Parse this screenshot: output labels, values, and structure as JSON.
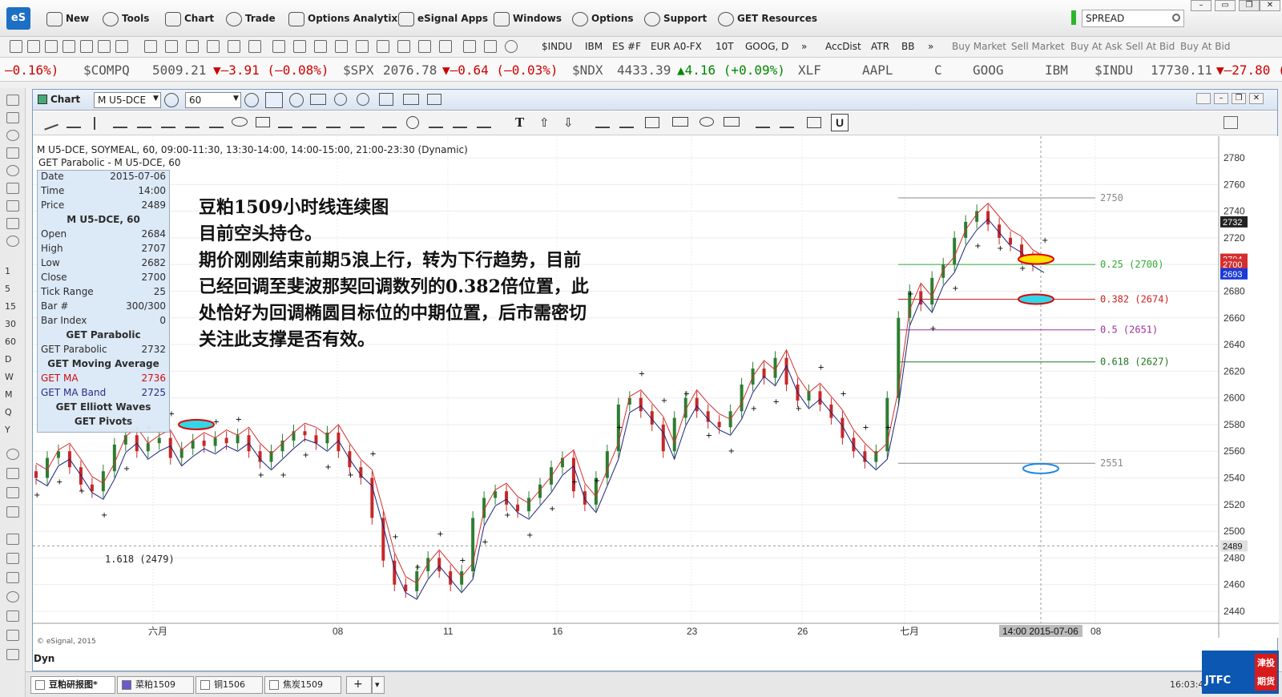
{
  "menu": {
    "logo": "eS",
    "items": [
      "New",
      "Tools",
      "Chart",
      "Trade",
      "Options Analytix",
      "eSignal Apps",
      "Windows",
      "Options",
      "Support",
      "GET Resources"
    ],
    "search_value": "SPREAD"
  },
  "toolbar2": {
    "symbols": [
      "$INDU",
      "IBM",
      "ES #F",
      "EUR A0-FX",
      "10T",
      "GOOG, D"
    ],
    "studies": [
      "AccDist",
      "ATR",
      "BB"
    ],
    "trade": [
      "Buy Market",
      "Sell Market",
      "Buy At Ask",
      "Sell At Bid",
      "Buy At Bid"
    ]
  },
  "ticker": {
    "lead": "–0.16%)",
    "items": [
      {
        "sym": "$COMPQ",
        "last": "5009.21",
        "chg": "▼–3.91 (–0.08%)",
        "dir": "down"
      },
      {
        "sym": "$SPX",
        "last": "2076.78",
        "chg": "▼–0.64 (–0.03%)",
        "dir": "down"
      },
      {
        "sym": "$NDX",
        "last": "4433.39",
        "chg": "▲4.16 (+0.09%)",
        "dir": "up"
      },
      {
        "sym": "XLF",
        "last": "",
        "chg": "",
        "dir": "none"
      },
      {
        "sym": "AAPL",
        "last": "",
        "chg": "",
        "dir": "none"
      },
      {
        "sym": "C",
        "last": "",
        "chg": "",
        "dir": "none"
      },
      {
        "sym": "GOOG",
        "last": "",
        "chg": "",
        "dir": "none"
      },
      {
        "sym": "IBM",
        "last": "",
        "chg": "",
        "dir": "none"
      },
      {
        "sym": "$INDU",
        "last": "17730.11",
        "chg": "▼–27.80 (",
        "dir": "down"
      }
    ]
  },
  "left_letters": [
    "1",
    "5",
    "15",
    "30",
    "60",
    "D",
    "W",
    "M",
    "Q",
    "Y"
  ],
  "chart_window": {
    "title": "Chart",
    "symbol": "M U5-DCE",
    "interval": "60",
    "header": "M U5-DCE, SOYMEAL, 60, 09:00-11:30, 13:30-14:00, 14:00-15:00, 21:00-23:30 (Dynamic)",
    "studies_header": "GET Parabolic - M U5-DCE, 60",
    "dyn": "Dyn",
    "watermark": "© eSignal, 2015"
  },
  "data_panel": {
    "rows_top": [
      {
        "k": "Date",
        "v": "2015-07-06"
      },
      {
        "k": "Time",
        "v": "14:00"
      },
      {
        "k": "Price",
        "v": "2489"
      }
    ],
    "symbol_head": "M U5-DCE, 60",
    "ohlc": [
      {
        "k": "Open",
        "v": "2684"
      },
      {
        "k": "High",
        "v": "2707"
      },
      {
        "k": "Low",
        "v": "2682"
      },
      {
        "k": "Close",
        "v": "2700"
      },
      {
        "k": "Tick Range",
        "v": "25"
      },
      {
        "k": "Bar #",
        "v": "300/300"
      },
      {
        "k": "Bar Index",
        "v": "0"
      }
    ],
    "parabolic_head": "GET Parabolic",
    "parabolic": {
      "k": "GET Parabolic",
      "v": "2732"
    },
    "ma_head": "GET Moving Average",
    "ma": {
      "k": "GET MA",
      "v": "2736"
    },
    "maband": {
      "k": "GET MA Band",
      "v": "2725"
    },
    "elliott_head": "GET Elliott Waves",
    "pivots_head": "GET Pivots"
  },
  "annotation": [
    "豆粕1509小时线连续图",
    "目前空头持仓。",
    "期价刚刚结束前期5浪上行，转为下行趋势，目前",
    "已经回调至斐波那契回调数列的0.382倍位置，此",
    "处恰好为回调椭圆目标位的中期位置，后市需密切",
    "关注此支撑是否有效。"
  ],
  "price_axis": [
    "2780",
    "2760",
    "2740",
    "2720",
    "2700",
    "2680",
    "2660",
    "2640",
    "2620",
    "2600",
    "2580",
    "2560",
    "2540",
    "2520",
    "2500",
    "2480",
    "2460",
    "2440"
  ],
  "price_tags": {
    "last": "2732",
    "red1": "2704",
    "red2": "2700",
    "blue": "2693",
    "cross": "2489"
  },
  "time_axis": [
    "六月",
    "08",
    "11",
    "16",
    "23",
    "26",
    "七月",
    "08"
  ],
  "time_cursor": "14:00 2015-07-06",
  "fib_levels": [
    {
      "label": "2750",
      "price": 2750,
      "color": "#888888"
    },
    {
      "label": "0.25 (2700)",
      "price": 2700,
      "color": "#33aa33"
    },
    {
      "label": "0.382 (2674)",
      "price": 2674,
      "color": "#cc2222"
    },
    {
      "label": "0.5 (2651)",
      "price": 2651,
      "color": "#993399"
    },
    {
      "label": "0.618 (2627)",
      "price": 2627,
      "color": "#227722"
    },
    {
      "label": "2551",
      "price": 2551,
      "color": "#888888"
    }
  ],
  "fib_left": "1.618 (2479)",
  "bottom_tabs": [
    "豆粕研报图*",
    "菜粕1509",
    "铜1506",
    "焦炭1509"
  ],
  "status_time": "16:03:41 GMT+8",
  "badge": {
    "top": "JTFC",
    "side": "津投期货"
  },
  "colors": {
    "accent": "#1c6fc4",
    "up": "#008800",
    "down": "#cc0000",
    "wave": "#1e88e5",
    "ma": "#d32f2f",
    "band": "#1a237e"
  }
}
